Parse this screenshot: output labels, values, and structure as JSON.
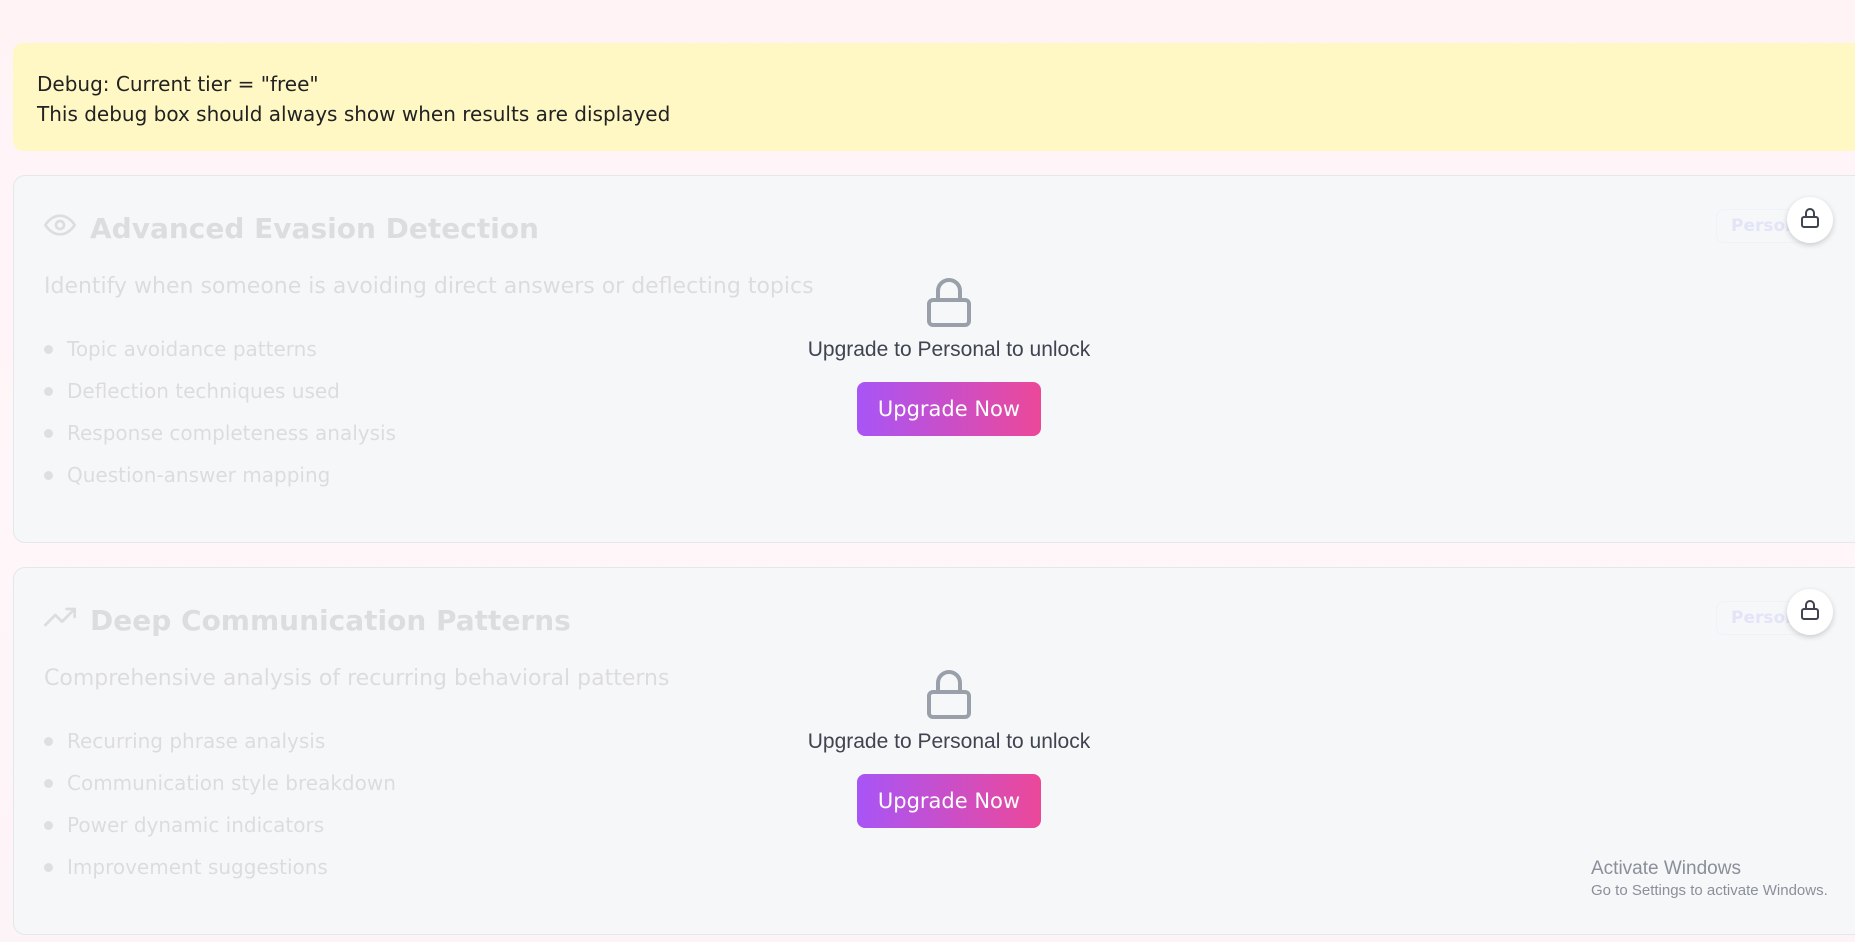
{
  "debug": {
    "line1": "Debug: Current tier = \"free\"",
    "line2": "This debug box should always show when results are displayed"
  },
  "cards": [
    {
      "title": "Advanced Evasion Detection",
      "icon": "eye-icon",
      "description": "Identify when someone is avoiding direct answers or deflecting topics",
      "features": [
        "Topic avoidance patterns",
        "Deflection techniques used",
        "Response completeness analysis",
        "Question-answer mapping"
      ],
      "badge": "Person",
      "overlay_text": "Upgrade to Personal to unlock",
      "button": "Upgrade Now"
    },
    {
      "title": "Deep Communication Patterns",
      "icon": "trending-up-icon",
      "description": "Comprehensive analysis of recurring behavioral patterns",
      "features": [
        "Recurring phrase analysis",
        "Communication style breakdown",
        "Power dynamic indicators",
        "Improvement suggestions"
      ],
      "badge": "Person",
      "overlay_text": "Upgrade to Personal to unlock",
      "button": "Upgrade Now"
    }
  ],
  "watermark": {
    "line1": "Activate Windows",
    "line2": "Go to Settings to activate Windows."
  },
  "colors": {
    "debug_bg": "#fff8c4",
    "button_start": "#a855f7",
    "button_end": "#ec4899"
  }
}
